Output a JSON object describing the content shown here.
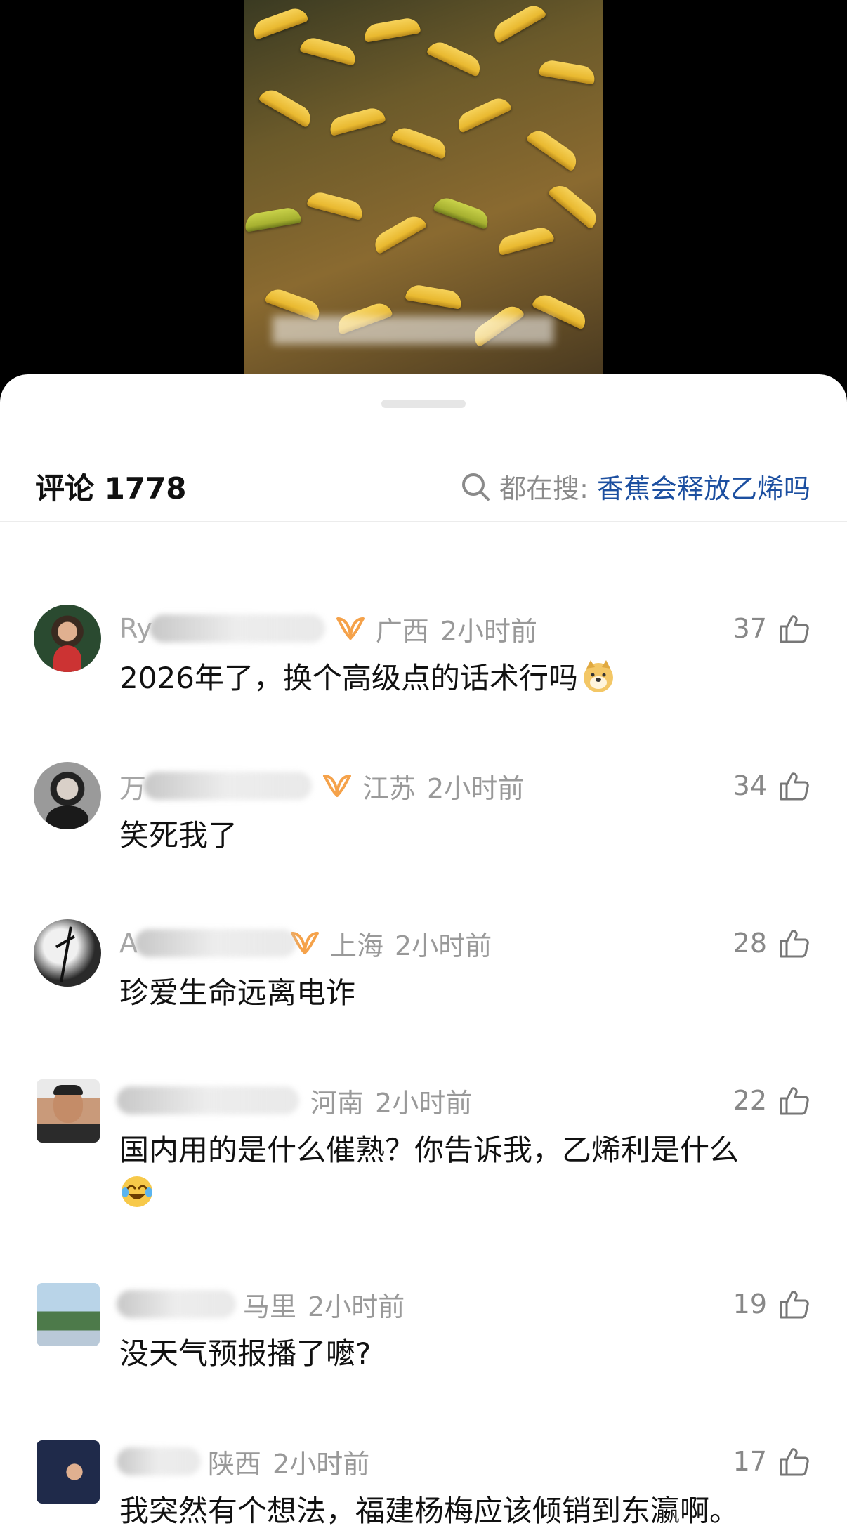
{
  "header": {
    "comment_label": "评论 1778",
    "search_prefix": "都在搜:",
    "search_term": "香蕉会释放乙烯吗"
  },
  "comments": [
    {
      "username": "Ry",
      "region": "广西",
      "time": "2小时前",
      "likes": "37",
      "text": "2026年了，换个高级点的话术行吗",
      "emoji": "doge-emoji"
    },
    {
      "username": "万",
      "region": "江苏",
      "time": "2小时前",
      "likes": "34",
      "text": "笑死我了"
    },
    {
      "username": "A",
      "region": "上海",
      "time": "2小时前",
      "likes": "28",
      "text": "珍爱生命远离电诈"
    },
    {
      "username": "",
      "region": "河南",
      "time": "2小时前",
      "likes": "22",
      "text": "国内用的是什么催熟？你告诉我，乙烯利是什么",
      "emoji": "laugh-cry-emoji"
    },
    {
      "username": "",
      "region": "马里",
      "time": "2小时前",
      "likes": "19",
      "text": "没天气预报播了嚒?"
    },
    {
      "username": "",
      "region": "陕西",
      "time": "2小时前",
      "likes": "17",
      "text": "我突然有个想法，福建杨梅应该倾销到东瀛啊。"
    }
  ],
  "colors": {
    "accent_link": "#1c4fa0",
    "meta_gray": "#999999",
    "vip_orange": "#f5a24a"
  }
}
